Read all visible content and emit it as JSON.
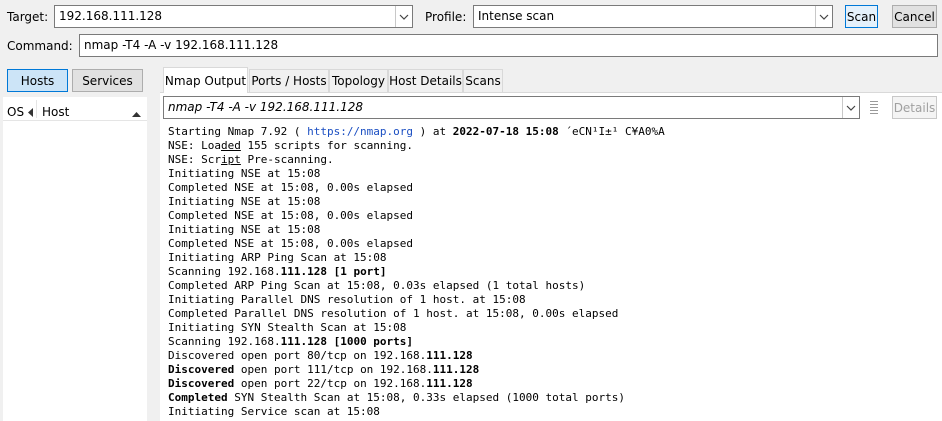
{
  "toolbar": {
    "target_label": "Target:",
    "target_value": "192.168.111.128",
    "profile_label": "Profile:",
    "profile_value": "Intense scan",
    "scan_label": "Scan",
    "cancel_label": "Cancel"
  },
  "command": {
    "label": "Command:",
    "value": "nmap -T4 -A -v 192.168.111.128"
  },
  "left_panel": {
    "hosts_tab": "Hosts",
    "services_tab": "Services",
    "col_os": "OS",
    "col_host": "Host"
  },
  "tabs": [
    "Nmap Output",
    "Ports / Hosts",
    "Topology",
    "Host Details",
    "Scans"
  ],
  "output_header": {
    "command": "nmap -T4 -A -v 192.168.111.128",
    "details_label": "Details"
  },
  "output": {
    "l1_a": "Starting Nmap 7.92 ( ",
    "l1_url": "https://nmap.org",
    "l1_b": " ) at ",
    "l1_ts": "2022-07-18 15:08",
    "l1_c": " ´eCN¹I±¹ C¥A0%A",
    "l2_a": "NSE: Loa",
    "l2_u": "ded",
    "l2_b": " 155 scripts for scanning.",
    "l3_a": "NSE: Scr",
    "l3_u": "ipt",
    "l3_b": " Pre-scanning.",
    "l4": "Initiating NSE at 15:08",
    "l5": "Completed NSE at 15:08, 0.00s elapsed",
    "l6": "Initiating NSE at 15:08",
    "l7": "Completed NSE at 15:08, 0.00s elapsed",
    "l8": "Initiating NSE at 15:08",
    "l9": "Completed NSE at 15:08, 0.00s elapsed",
    "l10": "Initiating ARP Ping Scan at 15:08",
    "l11_a": "Scanning 192.168.",
    "l11_b": "111.128 [1 port]",
    "l12": "Completed ARP Ping Scan at 15:08, 0.03s elapsed (1 total hosts)",
    "l13": "Initiating Parallel DNS resolution of 1 host. at 15:08",
    "l14": "Completed Parallel DNS resolution of 1 host. at 15:08, 0.00s elapsed",
    "l15": "Initiating SYN Stealth Scan at 15:08",
    "l16_a": "Scanning 192.168.",
    "l16_b": "111.128 [1000 ports]",
    "l17_a": "Discovered open port 80/tcp on 192.168.",
    "l17_b": "111.128",
    "l18_a": "Discovered",
    "l18_b": " open port 111/tcp on 192.168.",
    "l18_c": "111.128",
    "l19_a": "Discovered",
    "l19_b": " open port 22/tcp on 192.168.",
    "l19_c": "111.128",
    "l20_a": "Completed",
    "l20_b": " SYN Stealth Scan at 15:08, 0.33s elapsed (1000 total ports)",
    "l21": "Initiating Service scan at 15:08"
  }
}
